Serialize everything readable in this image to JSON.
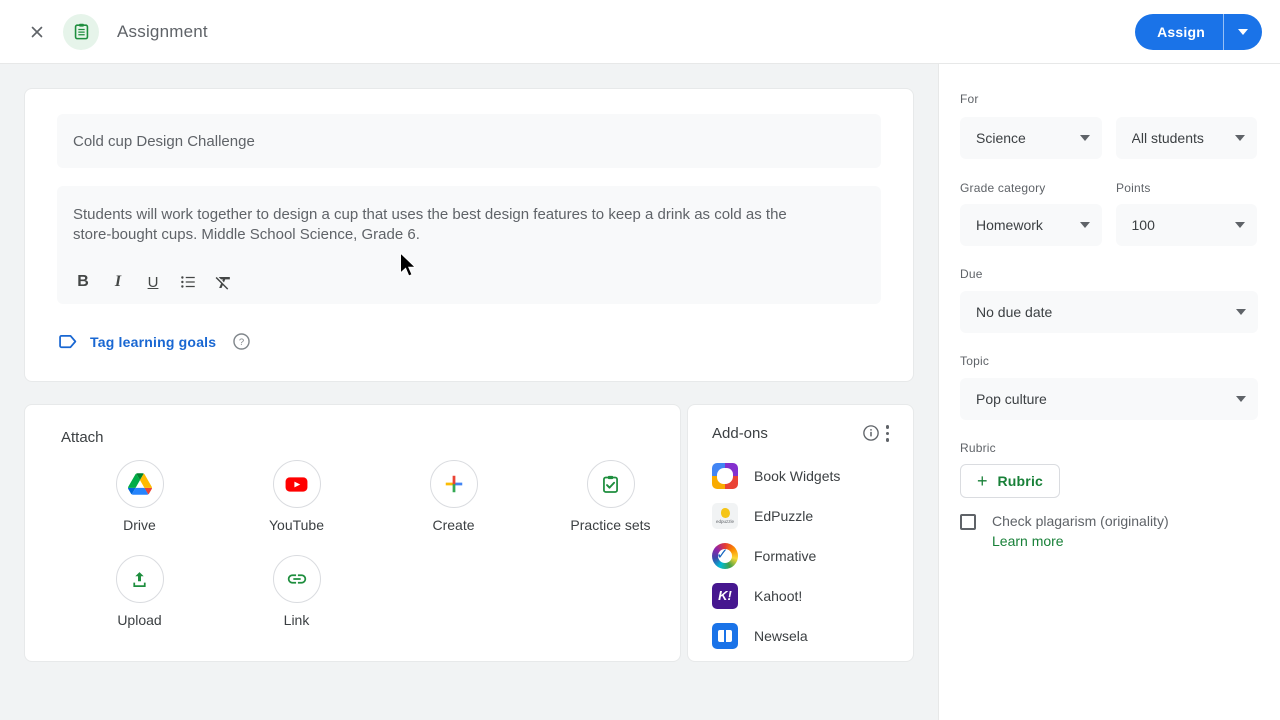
{
  "topbar": {
    "title": "Assignment",
    "assign_button": "Assign"
  },
  "assignment_form": {
    "title": "Cold cup Design Challenge",
    "description": "Students will work together to design a cup that uses the best design features to keep a drink as cold as the store-bought cups. Middle School Science, Grade 6.",
    "toolbar": {
      "bold": "B",
      "italic": "I",
      "underline": "U"
    },
    "tag_learning_goals": "Tag learning goals"
  },
  "attach": {
    "header": "Attach",
    "items": [
      {
        "label": "Drive",
        "icon": "google-drive-icon"
      },
      {
        "label": "YouTube",
        "icon": "youtube-icon"
      },
      {
        "label": "Create",
        "icon": "create-plus-icon"
      },
      {
        "label": "Practice sets",
        "icon": "practice-sets-icon"
      },
      {
        "label": "Upload",
        "icon": "upload-icon"
      },
      {
        "label": "Link",
        "icon": "link-icon"
      }
    ]
  },
  "addons": {
    "header": "Add-ons",
    "items": [
      {
        "label": "Book Widgets",
        "icon": "book-widgets-icon",
        "icon_text": ""
      },
      {
        "label": "EdPuzzle",
        "icon": "edpuzzle-icon",
        "icon_text": "edpuzzle"
      },
      {
        "label": "Formative",
        "icon": "formative-icon",
        "icon_text": ""
      },
      {
        "label": "Kahoot!",
        "icon": "kahoot-icon",
        "icon_text": "K!"
      },
      {
        "label": "Newsela",
        "icon": "newsela-icon",
        "icon_text": ""
      }
    ]
  },
  "sidebar": {
    "for_label": "For",
    "class_select": "Science",
    "students_select": "All students",
    "grade_category_label": "Grade category",
    "grade_category_select": "Homework",
    "points_label": "Points",
    "points_select": "100",
    "due_label": "Due",
    "due_select": "No due date",
    "topic_label": "Topic",
    "topic_select": "Pop culture",
    "rubric_label": "Rubric",
    "rubric_button": "Rubric",
    "plagiarism_checkbox_label": "Check plagarism (originality)",
    "learn_more_link": "Learn more"
  },
  "colors": {
    "assign_blue": "#1a73e8",
    "link_blue": "#1967d2",
    "green": "#188038",
    "icon_green": "#1e8e3e",
    "field_bg": "#f8f9fa",
    "canvas_bg": "#f1f3f4"
  }
}
